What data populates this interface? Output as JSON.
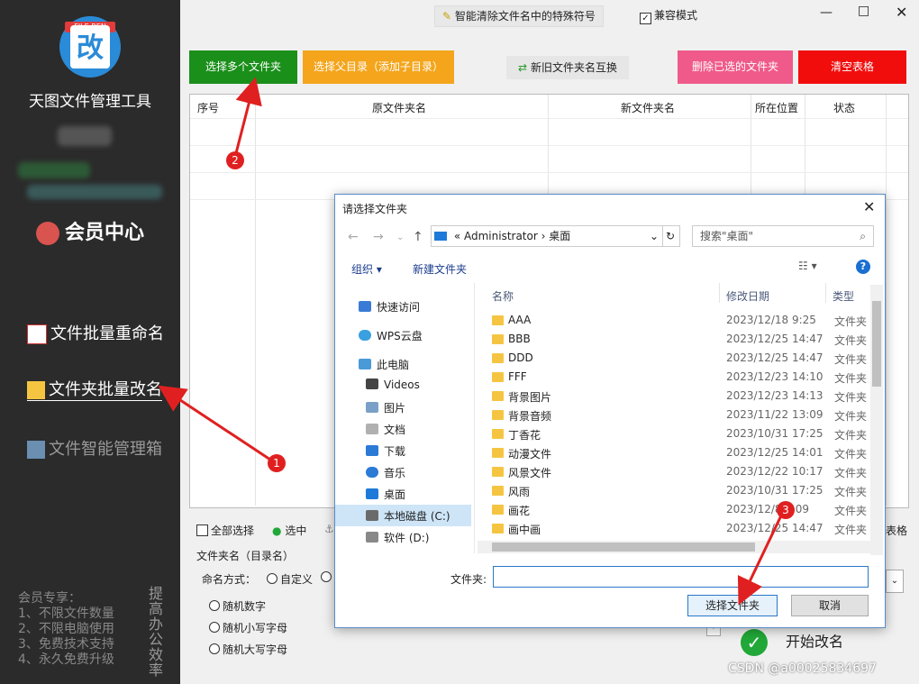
{
  "sidebar": {
    "logo_text": "改",
    "logo_tag": "FILE REN",
    "app_title": "天图文件管理工具",
    "member_center": "会员中心",
    "items": [
      {
        "label": "文件批量重命名"
      },
      {
        "label": "文件夹批量改名"
      },
      {
        "label": "文件智能管理箱"
      }
    ],
    "promo_lines": [
      "会员专享：",
      "1、不限文件数量",
      "2、不限电脑使用",
      "3、免费技术支持",
      "4、永久免费升级"
    ],
    "promo_vertical": "提高办公效率"
  },
  "topbar": {
    "smart_clean": "智能清除文件名中的特殊符号",
    "compat_mode": "兼容模式"
  },
  "toolbar": {
    "select_multiple": "选择多个文件夹",
    "select_parent": "选择父目录（添加子目录）",
    "swap_names": "新旧文件夹名互换",
    "delete_selected": "删除已选的文件夹",
    "clear_table": "清空表格"
  },
  "table": {
    "headers": [
      "序号",
      "原文件夹名",
      "新文件夹名",
      "所在位置",
      "状态"
    ]
  },
  "bottom": {
    "select_all": "全部选择",
    "select": "选中",
    "partial_right": "表格",
    "folder_name_label": "文件夹名（目录名）",
    "naming_method": "命名方式：",
    "custom": "自定义",
    "options": [
      "随机数字",
      "随机小写字母",
      "随机大写字母"
    ],
    "start_rename": "开始改名"
  },
  "dialog": {
    "title": "请选择文件夹",
    "path": [
      "Administrator",
      "桌面"
    ],
    "search_placeholder": "搜索\"桌面\"",
    "organize": "组织",
    "new_folder": "新建文件夹",
    "nav": [
      "快速访问",
      "WPS云盘",
      "此电脑",
      "Videos",
      "图片",
      "文档",
      "下载",
      "音乐",
      "桌面",
      "本地磁盘 (C:)",
      "软件 (D:)"
    ],
    "columns": [
      "名称",
      "修改日期",
      "类型"
    ],
    "files": [
      {
        "name": "AAA",
        "date": "2023/12/18 9:25",
        "type": "文件夹"
      },
      {
        "name": "BBB",
        "date": "2023/12/25 14:47",
        "type": "文件夹"
      },
      {
        "name": "DDD",
        "date": "2023/12/25 14:47",
        "type": "文件夹"
      },
      {
        "name": "FFF",
        "date": "2023/12/23 14:10",
        "type": "文件夹"
      },
      {
        "name": "背景图片",
        "date": "2023/12/23 14:13",
        "type": "文件夹"
      },
      {
        "name": "背景音频",
        "date": "2023/11/22 13:09",
        "type": "文件夹"
      },
      {
        "name": "丁香花",
        "date": "2023/10/31 17:25",
        "type": "文件夹"
      },
      {
        "name": "动漫文件",
        "date": "2023/12/25 14:01",
        "type": "文件夹"
      },
      {
        "name": "风景文件",
        "date": "2023/12/22 10:17",
        "type": "文件夹"
      },
      {
        "name": "风雨",
        "date": "2023/10/31 17:25",
        "type": "文件夹"
      },
      {
        "name": "画花",
        "date": "2023/12/8 ...09",
        "type": "文件夹"
      },
      {
        "name": "画中画",
        "date": "2023/12/25 14:47",
        "type": "文件夹"
      }
    ],
    "folder_label": "文件夹:",
    "folder_value": "",
    "select_button": "选择文件夹",
    "cancel_button": "取消"
  },
  "annotations": [
    "1",
    "2",
    "3"
  ],
  "watermark": "CSDN @a00025834697",
  "colors": {
    "sidebar_bg": "#2b2b2b",
    "green": "#1a8f1a",
    "orange": "#f4a51c",
    "pink": "#ef5a8a",
    "red": "#f20d0d",
    "annotation_red": "#e02020"
  }
}
